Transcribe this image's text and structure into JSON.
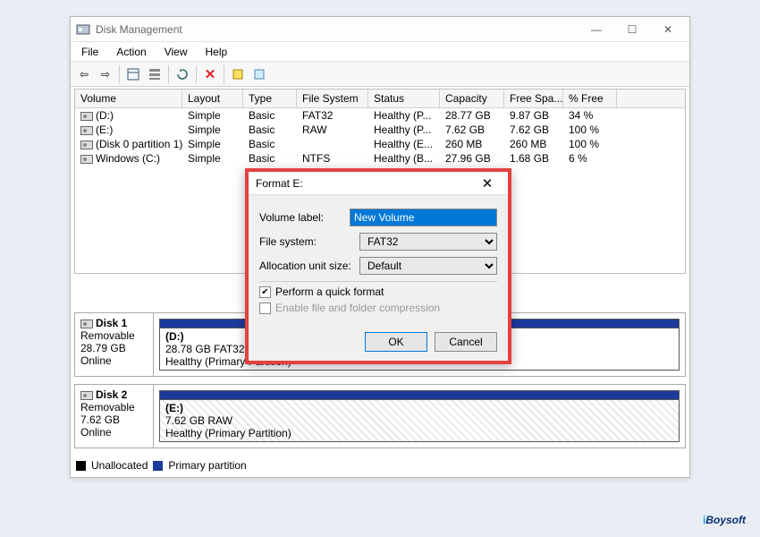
{
  "window": {
    "title": "Disk Management",
    "menus": [
      "File",
      "Action",
      "View",
      "Help"
    ]
  },
  "columns": [
    "Volume",
    "Layout",
    "Type",
    "File System",
    "Status",
    "Capacity",
    "Free Spa...",
    "% Free"
  ],
  "volumes": [
    {
      "name": "(D:)",
      "layout": "Simple",
      "type": "Basic",
      "fs": "FAT32",
      "status": "Healthy (P...",
      "capacity": "28.77 GB",
      "free": "9.87 GB",
      "pct": "34 %"
    },
    {
      "name": "(E:)",
      "layout": "Simple",
      "type": "Basic",
      "fs": "RAW",
      "status": "Healthy (P...",
      "capacity": "7.62 GB",
      "free": "7.62 GB",
      "pct": "100 %"
    },
    {
      "name": "(Disk 0 partition 1)",
      "layout": "Simple",
      "type": "Basic",
      "fs": "",
      "status": "Healthy (E...",
      "capacity": "260 MB",
      "free": "260 MB",
      "pct": "100 %"
    },
    {
      "name": "Windows (C:)",
      "layout": "Simple",
      "type": "Basic",
      "fs": "NTFS",
      "status": "Healthy (B...",
      "capacity": "27.96 GB",
      "free": "1.68 GB",
      "pct": "6 %"
    }
  ],
  "disks": [
    {
      "name": "Disk 1",
      "type": "Removable",
      "size": "28.79 GB",
      "state": "Online",
      "part_label": "(D:)",
      "part_desc": "28.78 GB FAT32",
      "part_status": "Healthy (Primary Partition)",
      "hatched": false
    },
    {
      "name": "Disk 2",
      "type": "Removable",
      "size": "7.62 GB",
      "state": "Online",
      "part_label": "(E:)",
      "part_desc": "7.62 GB RAW",
      "part_status": "Healthy (Primary Partition)",
      "hatched": true
    }
  ],
  "legend": {
    "unallocated": "Unallocated",
    "primary": "Primary partition"
  },
  "dialog": {
    "title": "Format E:",
    "volume_label_lbl": "Volume label:",
    "volume_label_val": "New Volume",
    "fs_lbl": "File system:",
    "fs_val": "FAT32",
    "aus_lbl": "Allocation unit size:",
    "aus_val": "Default",
    "quick_fmt": "Perform a quick format",
    "compression": "Enable file and folder compression",
    "ok": "OK",
    "cancel": "Cancel"
  },
  "watermark": "iBoysoft"
}
